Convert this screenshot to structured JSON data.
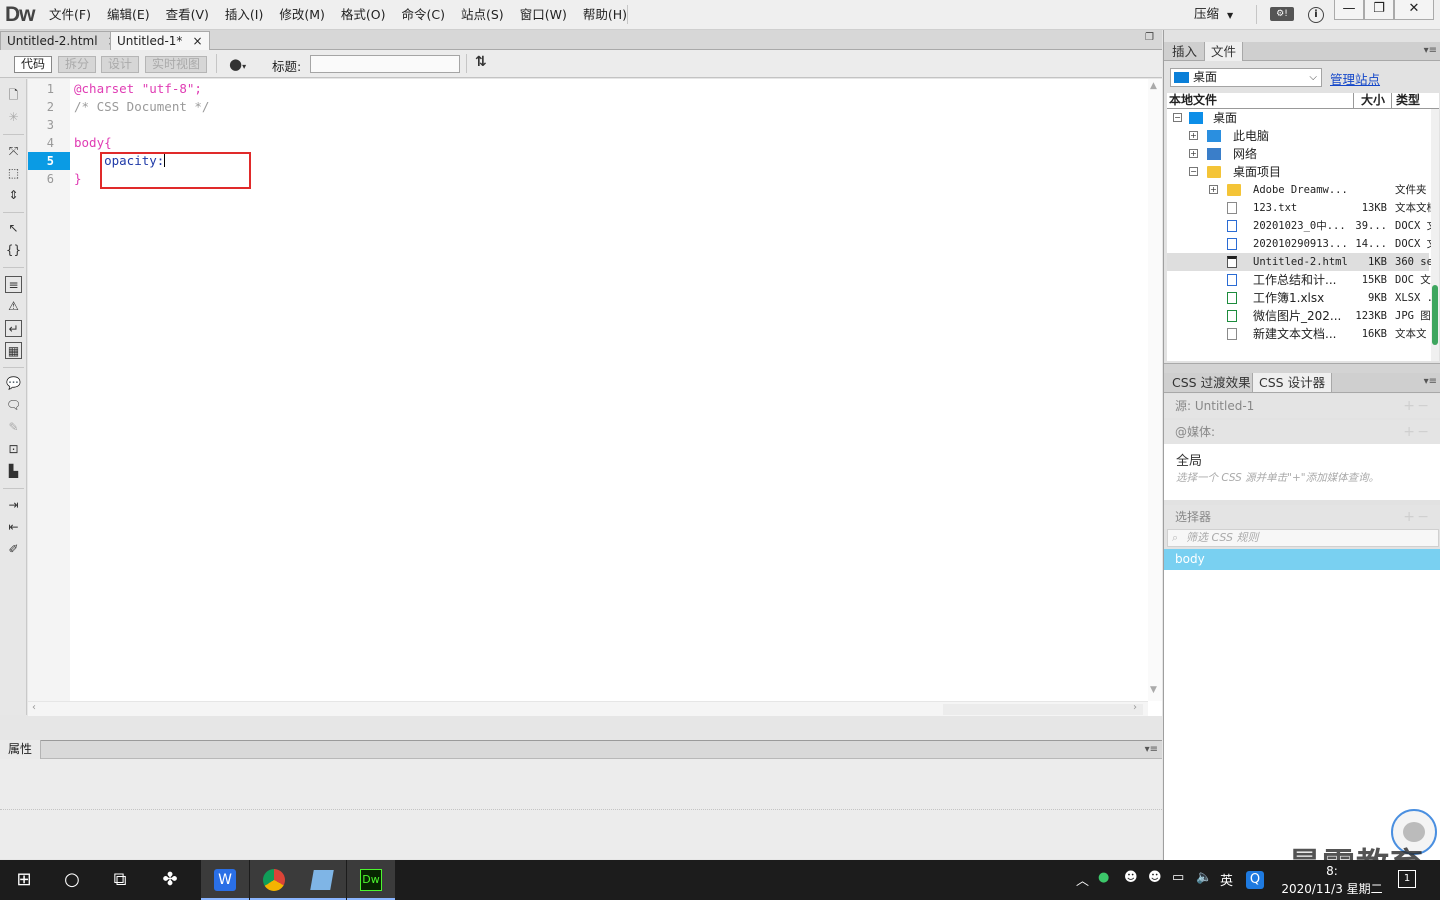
{
  "app": {
    "logo": "Dw",
    "menus": [
      "文件(F)",
      "编辑(E)",
      "查看(V)",
      "插入(I)",
      "修改(M)",
      "格式(O)",
      "命令(C)",
      "站点(S)",
      "窗口(W)",
      "帮助(H)"
    ],
    "compress_label": "压缩",
    "window_controls": [
      "—",
      "❐",
      "✕"
    ]
  },
  "doc_tabs": [
    {
      "label": "Untitled-2.html",
      "close": "×"
    },
    {
      "label": "Untitled-1*",
      "close": "×"
    }
  ],
  "doc_toolbar": {
    "views": [
      "代码",
      "拆分",
      "设计",
      "实时视图"
    ],
    "active_view": "代码",
    "title_label": "标题:",
    "title_value": ""
  },
  "editor": {
    "line_numbers": [
      "1",
      "2",
      "3",
      "4",
      "5",
      "6"
    ],
    "current_line": "5",
    "lines": {
      "l1_at": "@charset",
      "l1_str": " \"utf-8\";",
      "l2": "/* CSS Document */",
      "l3": "",
      "l4": "body{",
      "l5": "    opacity:",
      "l6": "}"
    }
  },
  "properties_panel": {
    "tab": "属性"
  },
  "files_panel": {
    "tabs": [
      "插入",
      "文件"
    ],
    "active_tab": "文件",
    "site": "桌面",
    "manage_link": "管理站点",
    "columns": [
      "本地文件",
      "大小",
      "类型"
    ],
    "tree": [
      {
        "name": "桌面",
        "size": "",
        "type": ""
      },
      {
        "name": "此电脑",
        "size": "",
        "type": ""
      },
      {
        "name": "网络",
        "size": "",
        "type": ""
      },
      {
        "name": "桌面项目",
        "size": "",
        "type": ""
      },
      {
        "name": "Adobe Dreamw...",
        "size": "",
        "type": "文件夹"
      },
      {
        "name": "123.txt",
        "size": "13KB",
        "type": "文本文档"
      },
      {
        "name": "20201023_0中...",
        "size": "39...",
        "type": "DOCX 文"
      },
      {
        "name": "202010290913...",
        "size": "14...",
        "type": "DOCX 文"
      },
      {
        "name": "Untitled-2.html",
        "size": "1KB",
        "type": "360 se."
      },
      {
        "name": "工作总结和计...",
        "size": "15KB",
        "type": "DOC 文档"
      },
      {
        "name": "工作簿1.xlsx",
        "size": "9KB",
        "type": "XLSX ."
      },
      {
        "name": "微信图片_202...",
        "size": "123KB",
        "type": "JPG 图"
      },
      {
        "name": "新建文本文档...",
        "size": "16KB",
        "type": "文本文"
      }
    ]
  },
  "css_panel": {
    "tabs": [
      "CSS 过渡效果",
      "CSS 设计器"
    ],
    "active_tab": "CSS 设计器",
    "source_label": "源: Untitled-1",
    "media_label": "@媒体:",
    "media_all": "全局",
    "media_hint": "选择一个 CSS 源并单击\"+\"添加媒体查询。",
    "selectors_label": "选择器",
    "filter_placeholder": "筛选 CSS 规则",
    "selected_rule": "body"
  },
  "watermark": "最需教育",
  "taskbar": {
    "tray_ime": "英",
    "time": "8:",
    "date": "2020/11/3 星期二",
    "notif_count": "1"
  }
}
